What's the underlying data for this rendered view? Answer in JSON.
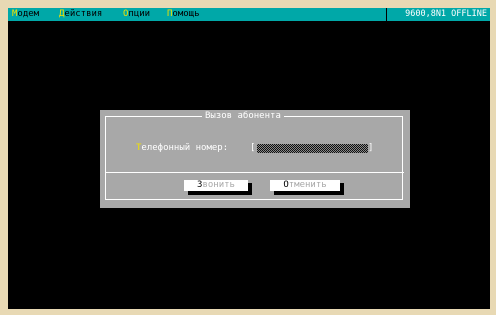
{
  "menubar": {
    "items": [
      {
        "hotkey": "М",
        "rest": "одем"
      },
      {
        "hotkey": "Д",
        "rest": "ействия"
      },
      {
        "hotkey": "О",
        "rest": "пции"
      },
      {
        "hotkey": "П",
        "rest": "омощь"
      }
    ],
    "status": "9600,8N1  OFFLINE"
  },
  "dialog": {
    "title": "Вызов абонента",
    "phone_label_hotkey": "Т",
    "phone_label_rest": "елефонный номер:",
    "bracket_open": "[",
    "bracket_close": "]",
    "phone_value": "",
    "call_button": {
      "hotkey": "З",
      "rest": "вонить"
    },
    "cancel_button": {
      "hotkey": "О",
      "rest": "тменить"
    }
  },
  "colors": {
    "screen_background": "#000000",
    "menubar_background": "#00a8a8",
    "menu_hotkey": "#f0e000",
    "dialog_background": "#a8a8a8",
    "button_background": "#ffffff"
  }
}
